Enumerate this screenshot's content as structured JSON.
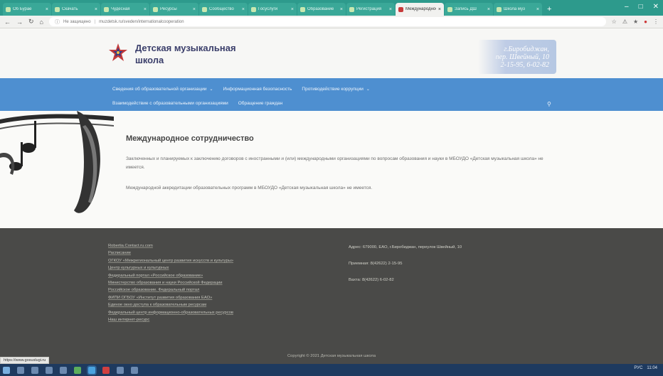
{
  "browser": {
    "tabs": [
      {
        "label": "Об Бурае",
        "active": false
      },
      {
        "label": "Скачать",
        "active": false
      },
      {
        "label": "Чудесная",
        "active": false
      },
      {
        "label": "Ресурсы",
        "active": false
      },
      {
        "label": "Сообщество",
        "active": false
      },
      {
        "label": "Госуслуги",
        "active": false
      },
      {
        "label": "Образование",
        "active": false
      },
      {
        "label": "Регистрация",
        "active": false
      },
      {
        "label": "Международное",
        "active": true
      },
      {
        "label": "Запись ДШ",
        "active": false
      },
      {
        "label": "Школа муз",
        "active": false
      }
    ],
    "new_tab": "+",
    "window_controls": [
      "–",
      "□",
      "✕"
    ],
    "nav_buttons": [
      "←",
      "→",
      "↻",
      "⌂"
    ],
    "url_security": "Не защищено",
    "url": "muzdetsk.ru/sveden/internationalcooperation",
    "toolbar_icons": [
      "☆",
      "⚠",
      "★",
      "●",
      "⋮"
    ]
  },
  "site": {
    "title": "Детская музыкальная школа",
    "contacts": {
      "line1": "г.Биробиджан,",
      "line2": "пер. Швейный, 10",
      "line3": "2-15-95, 6-02-82"
    }
  },
  "nav": {
    "row1": [
      {
        "label": "Сведения об образовательной организации",
        "dropdown": true
      },
      {
        "label": "Информационная безопасность",
        "dropdown": false
      },
      {
        "label": "Противодействие коррупции",
        "dropdown": true
      }
    ],
    "row2": [
      {
        "label": "Взаимодействие с образовательными организациями",
        "dropdown": false
      },
      {
        "label": "Обращение граждан",
        "dropdown": false
      }
    ],
    "search_icon": "search-icon"
  },
  "content": {
    "heading": "Международное сотрудничество",
    "paragraph1": "Заключенных и планируемых к заключению договоров с иностранными и (или) международными организациями по вопросам образования и науки в МБОУДО «Детская музыкальная школа» не имеется.",
    "paragraph2": "Международной аккредитации образовательных программ в МБОУДО «Детская музыкальная школа» не имеется."
  },
  "footer": {
    "links": [
      "Robertia.Contact.ru.com",
      "Расписание",
      "ОГКОУ «Межрегиональный центр развития искусств и культуры»",
      "Центр культурных и культурных",
      "Федеральный портал «Российское образование»",
      "Министерство образования и науки Российской Федерации",
      "Российское образование. Федеральный портал",
      "ФИПИ ОГБОУ «Институт развития образования ЕАО»",
      "Единое окно доступа к образовательным ресурсам",
      "Федеральный центр информационно-образовательных ресурсов",
      "Наш интернет-ресурс"
    ],
    "address": "Адрес: 679000, ЕАО, г.Биробиджан, переулок Швейный, 10",
    "reception": "Приемная: 8(42622) 2-15-95",
    "director": "Вахта: 8(42622) 6-02-82",
    "copyright": "Copyright © 2021 Детская музыкальная школа"
  },
  "status_url": "https://www.gosuslugi.ru",
  "taskbar": {
    "tray_time": "11:04",
    "tray_lang": "РУС"
  },
  "colors": {
    "tabstrip": "#2d9a8c",
    "nav": "#4e8fd0",
    "footer": "#4a4a48",
    "title": "#3a3e6a"
  }
}
